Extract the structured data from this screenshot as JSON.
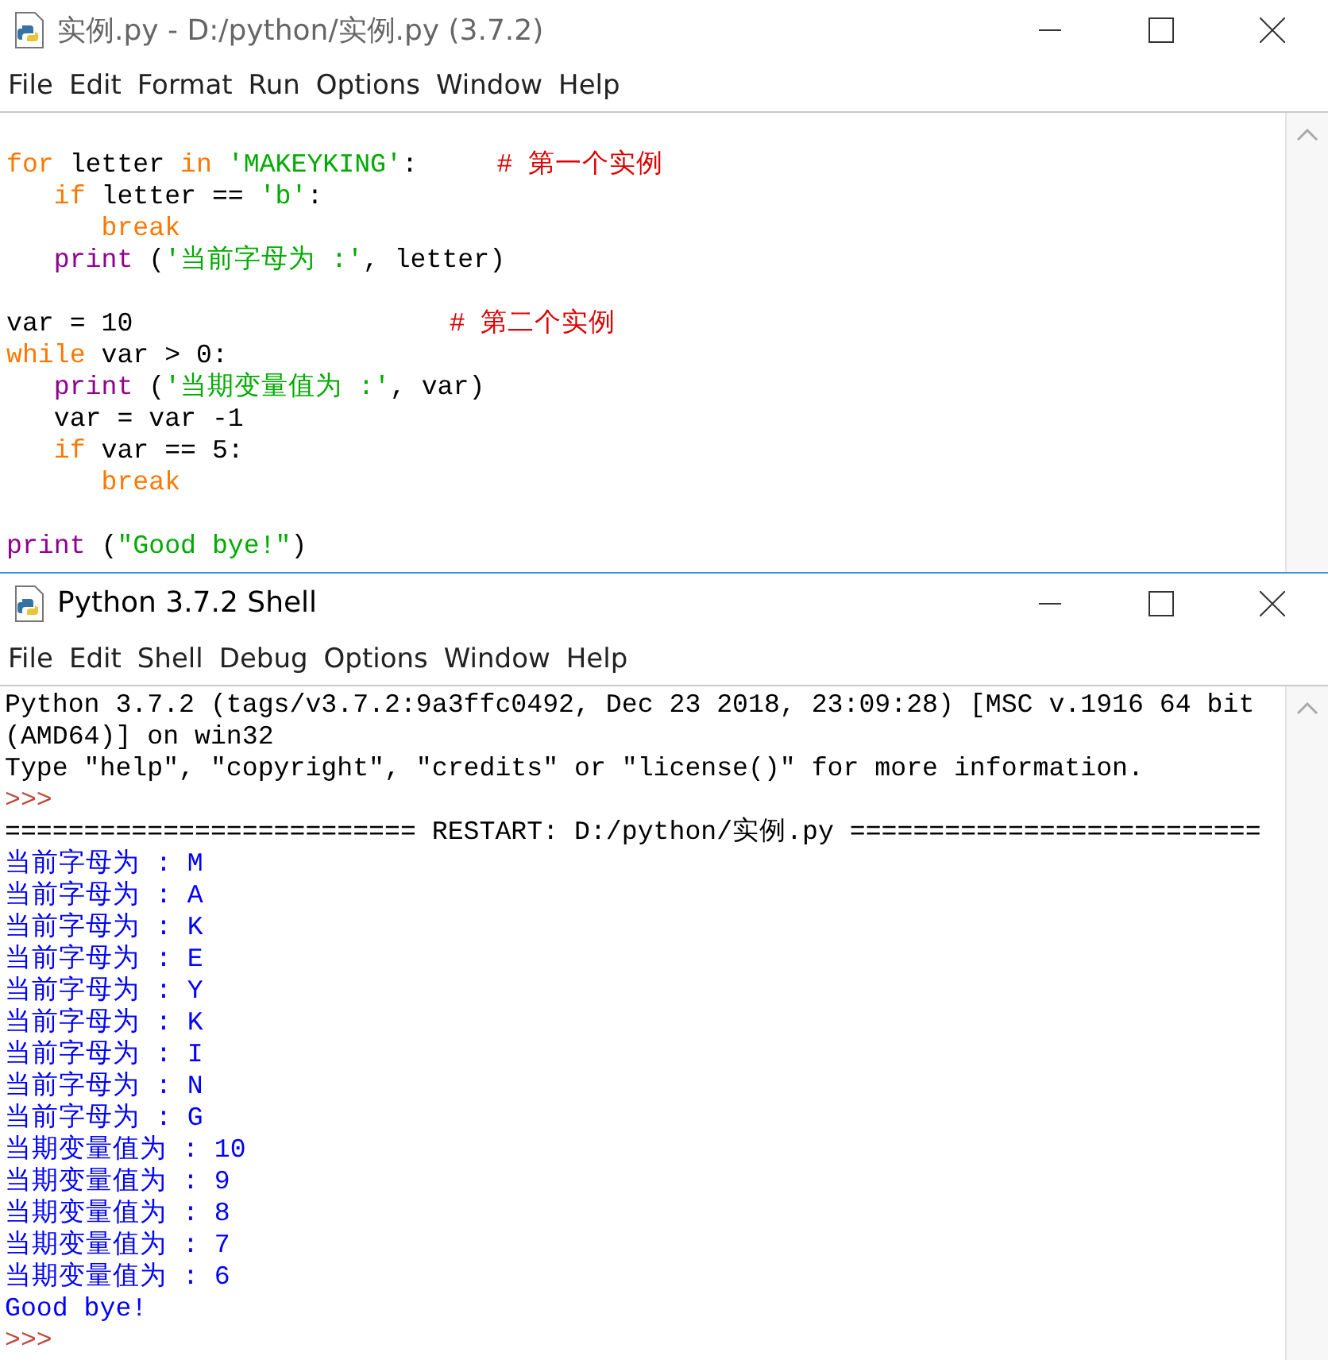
{
  "editor": {
    "title": "实例.py - D:/python/实例.py (3.7.2)",
    "menu": [
      "File",
      "Edit",
      "Format",
      "Run",
      "Options",
      "Window",
      "Help"
    ],
    "lines": [
      {
        "kind": "blank"
      },
      {
        "kind": "code",
        "tokens": [
          {
            "kind": "keyword",
            "s": "for"
          },
          {
            "kind": "plain",
            "s": " letter "
          },
          {
            "kind": "keyword",
            "s": "in"
          },
          {
            "kind": "string",
            "s": " 'MAKEYKING'"
          },
          {
            "kind": "plain",
            "s": ":     "
          },
          {
            "kind": "comment",
            "s": "# 第一个实例"
          }
        ]
      },
      {
        "kind": "code",
        "tokens": [
          {
            "kind": "keyword",
            "s": "   if"
          },
          {
            "kind": "plain",
            "s": " letter == "
          },
          {
            "kind": "string",
            "s": "'b'"
          },
          {
            "kind": "plain",
            "s": ":"
          }
        ]
      },
      {
        "kind": "code",
        "tokens": [
          {
            "kind": "keyword",
            "s": "      break"
          }
        ]
      },
      {
        "kind": "code",
        "tokens": [
          {
            "kind": "builtin",
            "s": "   print"
          },
          {
            "kind": "plain",
            "s": " ("
          },
          {
            "kind": "string",
            "s": "'当前字母为 :'"
          },
          {
            "kind": "plain",
            "s": ", letter)"
          }
        ]
      },
      {
        "kind": "blank"
      },
      {
        "kind": "code",
        "tokens": [
          {
            "kind": "plain",
            "s": "var = 10                    "
          },
          {
            "kind": "comment",
            "s": "# 第二个实例"
          }
        ]
      },
      {
        "kind": "code",
        "tokens": [
          {
            "kind": "keyword",
            "s": "while"
          },
          {
            "kind": "plain",
            "s": " var > 0:"
          }
        ]
      },
      {
        "kind": "code",
        "tokens": [
          {
            "kind": "builtin",
            "s": "   print"
          },
          {
            "kind": "plain",
            "s": " ("
          },
          {
            "kind": "string",
            "s": "'当期变量值为 :'"
          },
          {
            "kind": "plain",
            "s": ", var)"
          }
        ]
      },
      {
        "kind": "code",
        "tokens": [
          {
            "kind": "plain",
            "s": "   var = var -1"
          }
        ]
      },
      {
        "kind": "code",
        "tokens": [
          {
            "kind": "keyword",
            "s": "   if"
          },
          {
            "kind": "plain",
            "s": " var == 5:"
          }
        ]
      },
      {
        "kind": "code",
        "tokens": [
          {
            "kind": "keyword",
            "s": "      break"
          }
        ]
      },
      {
        "kind": "blank"
      },
      {
        "kind": "code",
        "tokens": [
          {
            "kind": "builtin",
            "s": "print"
          },
          {
            "kind": "plain",
            "s": " ("
          },
          {
            "kind": "string",
            "s": "\"Good bye!\""
          },
          {
            "kind": "plain",
            "s": ")"
          }
        ]
      }
    ]
  },
  "shell": {
    "title": "Python 3.7.2 Shell",
    "menu": [
      "File",
      "Edit",
      "Shell",
      "Debug",
      "Options",
      "Window",
      "Help"
    ],
    "lines": [
      {
        "kind": "banner",
        "text": "Python 3.7.2 (tags/v3.7.2:9a3ffc0492, Dec 23 2018, 23:09:28) [MSC v.1916 64 bit"
      },
      {
        "kind": "banner",
        "text": "(AMD64)] on win32"
      },
      {
        "kind": "banner",
        "text": "Type \"help\", \"copyright\", \"credits\" or \"license()\" for more information."
      },
      {
        "kind": "prompt",
        "text": ">>>"
      },
      {
        "kind": "banner",
        "text": "========================== RESTART: D:/python/实例.py =========================="
      },
      {
        "kind": "output",
        "text": "当前字母为 : M"
      },
      {
        "kind": "output",
        "text": "当前字母为 : A"
      },
      {
        "kind": "output",
        "text": "当前字母为 : K"
      },
      {
        "kind": "output",
        "text": "当前字母为 : E"
      },
      {
        "kind": "output",
        "text": "当前字母为 : Y"
      },
      {
        "kind": "output",
        "text": "当前字母为 : K"
      },
      {
        "kind": "output",
        "text": "当前字母为 : I"
      },
      {
        "kind": "output",
        "text": "当前字母为 : N"
      },
      {
        "kind": "output",
        "text": "当前字母为 : G"
      },
      {
        "kind": "output",
        "text": "当期变量值为 : 10"
      },
      {
        "kind": "output",
        "text": "当期变量值为 : 9"
      },
      {
        "kind": "output",
        "text": "当期变量值为 : 8"
      },
      {
        "kind": "output",
        "text": "当期变量值为 : 7"
      },
      {
        "kind": "output",
        "text": "当期变量值为 : 6"
      },
      {
        "kind": "output",
        "text": "Good bye!"
      },
      {
        "kind": "prompt",
        "text": ">>>"
      }
    ]
  }
}
